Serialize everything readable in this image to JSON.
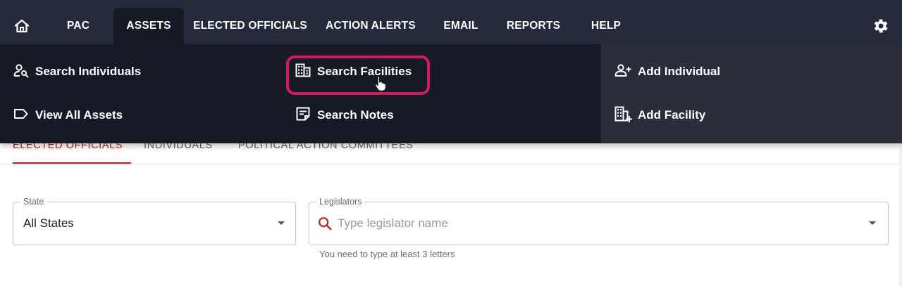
{
  "nav": {
    "items": [
      {
        "label": "PAC"
      },
      {
        "label": "ASSETS"
      },
      {
        "label": "ELECTED OFFICIALS"
      },
      {
        "label": "ACTION ALERTS"
      },
      {
        "label": "EMAIL"
      },
      {
        "label": "REPORTS"
      },
      {
        "label": "HELP"
      }
    ],
    "active": "ASSETS",
    "icons": {
      "home": "home-icon",
      "settings": "gear-icon"
    }
  },
  "assets_menu": {
    "search_individuals": "Search Individuals",
    "view_all_assets": "View All Assets",
    "search_facilities": "Search Facilities",
    "search_notes": "Search Notes",
    "add_individual": "Add Individual",
    "add_facility": "Add Facility"
  },
  "tabs": [
    {
      "label": "ELECTED OFFICIALS"
    },
    {
      "label": "INDIVIDUALS"
    },
    {
      "label": "POLITICAL ACTION COMMITTEES"
    }
  ],
  "state_field": {
    "label": "State",
    "value": "All States"
  },
  "legislators_field": {
    "label": "Legislators",
    "placeholder": "Type legislator name",
    "helper": "You need to type at least 3 letters"
  },
  "colors": {
    "nav_bg": "#252b3d",
    "menu_bg": "#151a25",
    "menu_right_bg": "#2b2d38",
    "highlight": "#d41a5e",
    "accent_red": "#c41e1e"
  }
}
